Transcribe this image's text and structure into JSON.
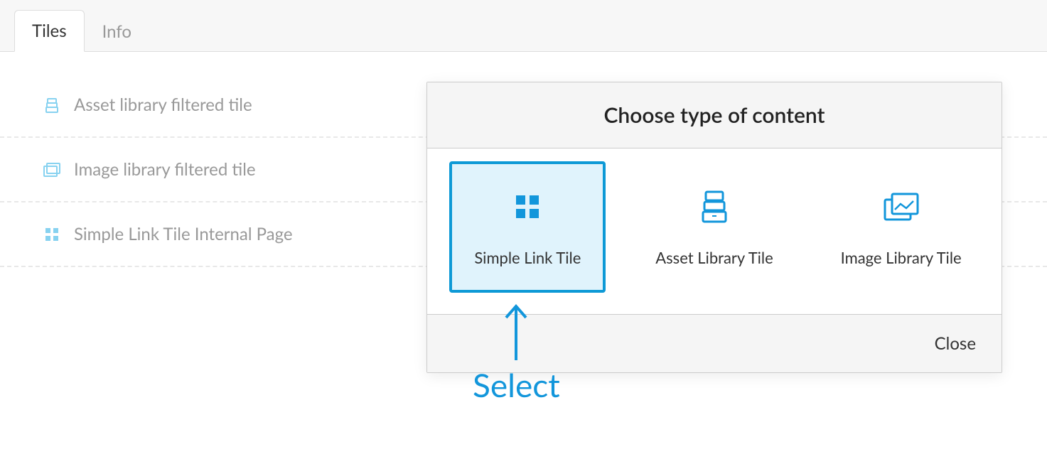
{
  "tabs": {
    "items": [
      {
        "label": "Tiles",
        "active": true
      },
      {
        "label": "Info",
        "active": false
      }
    ]
  },
  "list": {
    "items": [
      {
        "icon": "asset-library-icon",
        "label": "Asset library filtered tile"
      },
      {
        "icon": "image-library-icon",
        "label": "Image library filtered tile"
      },
      {
        "icon": "grid-icon",
        "label": "Simple Link Tile Internal Page"
      }
    ]
  },
  "modal": {
    "title": "Choose type of content",
    "options": [
      {
        "icon": "grid-icon",
        "label": "Simple Link Tile",
        "selected": true
      },
      {
        "icon": "asset-library-icon",
        "label": "Asset Library Tile",
        "selected": false
      },
      {
        "icon": "image-library-icon",
        "label": "Image Library Tile",
        "selected": false
      }
    ],
    "close_label": "Close"
  },
  "annotation": {
    "label": "Select"
  }
}
